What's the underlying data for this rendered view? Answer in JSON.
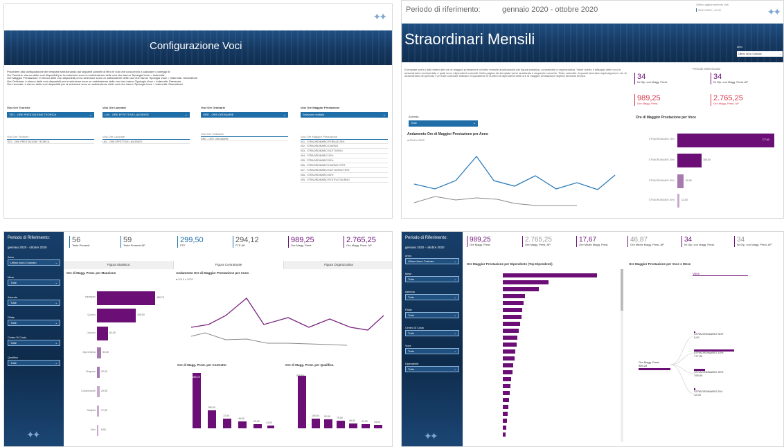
{
  "p1": {
    "title": "Configurazione Voci",
    "desc": [
      "Procedere alla configurazione dei template selezionando dai seguenti pannelli di filtro le voci che concorrono a calcolare i conteggi di:",
      "Ore Teoriche: elenco delle voci disponibili per la selezione sono un sottoinsieme delle voci che hanno Tipologia Voce = Indennità.",
      "Ore Maggior Prestazione: è elenco delle voci disponibili per la selezione sono un sottoinsieme delle voci che hanno Tipologia Voce = Indennità. Straordinari",
      "Ore Ordinarie: è elenco delle voci disponibili per la selezione sono un sottoinsieme delle voci che hanno Tipologia Voce = Indennità. Presenza",
      "Ore Lavorate: è elenco delle voci disponibili per la selezione sono un sottoinsieme delle voci che hanno Tipologia Voce = Indennità. Straordinari"
    ],
    "filters": [
      {
        "label": "Voci Ore Teoriche",
        "value": "TEO - ORE PRESTAZIONE TEORICA"
      },
      {
        "label": "Voci Ore Lavorate",
        "value": "LAV - ORE EFFETTIVE LAVORATE"
      },
      {
        "label": "Voci Ore Ordinarie",
        "value": "ORD - ORE ORDINARIE"
      },
      {
        "label": "Voci Ore Maggior Prestazione",
        "value": "Selezioni multiple"
      }
    ],
    "lists": [
      {
        "header": "Voci Ore Teoriche",
        "rows": [
          "TEO - ORE PRESTAZIONE TEORICA"
        ]
      },
      {
        "header": "Voci Ore Lavorate",
        "rows": [
          "LAV - ORE EFFETTIVE LAVORATE"
        ]
      },
      {
        "header": "Voci Ore Ordinarie",
        "rows": [
          "ORD - ORE ORDINARIE"
        ]
      },
      {
        "header": "Voci Ore Maggior Prestazione",
        "rows": [
          "001 - STRAORDINARIO FERIALE 25%",
          "002 - STRAORDINARIO DIURNO",
          "003 - STRAORDINARIO NOTTURNO",
          "004 - STRAORDINARIO 30%",
          "005 - STRAORDINARIO 50%",
          "006 - STRAORDINARIO DIURNO FEST.",
          "007 - STRAORDINARIO NOTTURNO FEST.",
          "008 - STRAORDINARIO 60%",
          "009 - STRAORDINARIO FESTIVO DIURNO"
        ]
      }
    ]
  },
  "p2": {
    "period_label": "Periodo di riferimento:",
    "period_value": "gennaio 2020 - ottobre 2020",
    "update_label": "Ultimo aggiornamento dati",
    "update_value": "05/11/2020 | 10:42",
    "title": "Straordinari Mensili",
    "anno_label": "Anno",
    "anno_value": "Ultimo Anno Caricato",
    "desc": "Il template porta i dati relativi alle ore di maggior prestazione a livello mensile analizzandoli per figura statistica, contrattuale e organizzativa. Viene fornito il dettaglio delle voci di straordinario movimentate e quali sono i dipendenti coinvolti. Nella pagina del template viene analizzato il seguente concetto: Teste coinvolte. A quanti lavoratori equivalgono le ore di straordinario del periodo? Le teste coinvolte indicano l'equivalente in numero di dipendenti delle ore di maggior prestazione rispetto all'orario teorico.",
    "periodo_sel": "Periodo Selezionato",
    "kpis": [
      {
        "value": "34",
        "label": "Nr Dip. con Magg. Prest."
      },
      {
        "value": "34",
        "label": "Nr Dip. con Magg. Prest. AP"
      },
      {
        "value": "989,25",
        "label": "Ore Magg. Prest."
      },
      {
        "value": "2.765,25",
        "label": "Ore Magg. Prest. AP"
      }
    ],
    "azienda_label": "Azienda",
    "azienda_value": "Tutte",
    "line_title": "Andamento Ore di Maggior Prestazione per Anno",
    "legend": [
      "2019",
      "2020"
    ],
    "bar_title": "Ore di Maggior Prestazione per Voce",
    "bar_labels": [
      "STRAORDINARIO 15%",
      "STRAORDINARIO 30%",
      "STRAORDINARIO 50%",
      "STRAORDINARIO 60%"
    ],
    "bar_values": [
      "777,00",
      "150,00",
      "50,00",
      "12,00"
    ]
  },
  "p3": {
    "period_label": "Periodo di Riferimento:",
    "period_value": "gennaio 2020 - ottobre 2020",
    "kpis": [
      {
        "value": "56",
        "label": "Teste Presenti"
      },
      {
        "value": "59",
        "label": "Teste Presenti AP"
      },
      {
        "value": "299,50",
        "label": "FTE"
      },
      {
        "value": "294,12",
        "label": "FTE AP"
      },
      {
        "value": "989,25",
        "label": "Ore Magg. Prest."
      },
      {
        "value": "2.765,25",
        "label": "Ore Magg. Prest. AP"
      }
    ],
    "filters": [
      {
        "label": "Anno",
        "value": "Ultimo Anno Caricato"
      },
      {
        "label": "Mese",
        "value": "Tutte"
      },
      {
        "label": "Azienda",
        "value": "Tutte"
      },
      {
        "label": "Filiale",
        "value": "Tutte"
      },
      {
        "label": "Centro Di Costo",
        "value": "Tutte"
      },
      {
        "label": "Qualifica",
        "value": "Tutte"
      }
    ],
    "tabs": [
      "Figura Statistica",
      "Figura Contrattuale",
      "Figura Organizzativa"
    ],
    "hbar_title": "Ore di Magg. Prest. per Mansione",
    "hbar_cats": [
      "Impiegato",
      "Quadro",
      "Operaio",
      "Apprendista",
      "Dirigente",
      "Collaboratore",
      "Stagista",
      "Altro"
    ],
    "hbar_values": [
      "480,75",
      "325,00",
      "82,00",
      "30,00",
      "22,00",
      "20,00",
      "17,00",
      "8,00"
    ],
    "line_title": "Andamento Ore di Maggior Prestazione per Anno",
    "legend": [
      "2019",
      "2020"
    ],
    "contratto_title": "Ore di Magg. Prest. per Contratto",
    "contratto_values": [
      "685,25",
      "150,00",
      "72,00",
      "48,00",
      "20,00",
      "14,00"
    ],
    "qualifica_title": "Ore di Magg. Prest. per Qualifica",
    "qualifica_values": [
      "575,50",
      "100,00",
      "92,00",
      "75,00",
      "46,00",
      "41,00",
      "34,00"
    ]
  },
  "p4": {
    "period_label": "Periodo di Riferimento:",
    "period_value": "gennaio 2020 - ottobre 2020",
    "kpis": [
      {
        "value": "989,25",
        "label": "Ore Magg. Prest."
      },
      {
        "value": "2.765,25",
        "label": "Ore Magg. Prest. AP"
      },
      {
        "value": "17,67",
        "label": "Ore Medie Magg. Prest."
      },
      {
        "value": "46,87",
        "label": "Ore Medie Magg. Prest. AP"
      },
      {
        "value": "34",
        "label": "Nr Dip. con Magg. Prest."
      },
      {
        "value": "34",
        "label": "Nr Dip. con Magg. Prest. AP"
      }
    ],
    "filters": [
      {
        "label": "Anno",
        "value": "Ultimo Anno Caricato"
      },
      {
        "label": "Mese",
        "value": "Tutte"
      },
      {
        "label": "Azienda",
        "value": "Tutte"
      },
      {
        "label": "Filiale",
        "value": "Tutte"
      },
      {
        "label": "Centro Di Costo",
        "value": "Tutte"
      },
      {
        "label": "Voce",
        "value": "Tutte"
      },
      {
        "label": "Dipendente",
        "value": "Tutte"
      }
    ],
    "hbar_title": "Ore Maggior Prestazione per Dipendente (Top Dipendenti)",
    "tree_title": "Ore Maggior Prestazione per Voce e Mese",
    "tree_root_label": "Ore Magg. Prest.",
    "tree_root_value": "989,25",
    "tree_header": "Voce",
    "tree_items": [
      {
        "label": "STRAORDINARIO NOT",
        "value": "0,00"
      },
      {
        "label": "STRAORDINARIO 15%",
        "value": "777,00"
      },
      {
        "label": "STRAORDINARIO 30%",
        "value": "195,00"
      },
      {
        "label": "STRAORDINARIO DIU",
        "value": "12,00"
      }
    ]
  }
}
